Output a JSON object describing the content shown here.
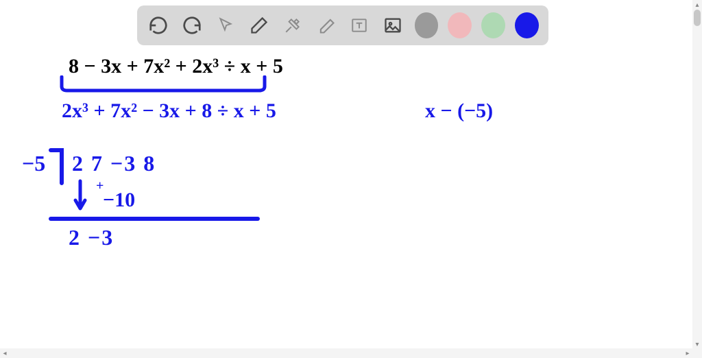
{
  "toolbar": {
    "tools": [
      {
        "name": "undo-icon",
        "type": "undo"
      },
      {
        "name": "redo-icon",
        "type": "redo"
      },
      {
        "name": "pointer-icon",
        "type": "pointer"
      },
      {
        "name": "pencil-icon",
        "type": "pencil"
      },
      {
        "name": "tools-icon",
        "type": "tools"
      },
      {
        "name": "eraser-icon",
        "type": "eraser"
      },
      {
        "name": "text-icon",
        "type": "text"
      },
      {
        "name": "image-icon",
        "type": "image"
      }
    ],
    "colors": [
      {
        "name": "color-gray",
        "hex": "#9a9a9a"
      },
      {
        "name": "color-pink",
        "hex": "#f1b8bb"
      },
      {
        "name": "color-green",
        "hex": "#aed9b3"
      },
      {
        "name": "color-blue",
        "hex": "#1819e8"
      }
    ]
  },
  "math": {
    "line1": "8 − 3x + 7x² + 2x³   ÷   x + 5",
    "line2": "2x³ + 7x² − 3x + 8   ÷  x + 5",
    "side_note": "x − (−5)",
    "syn_divisor": "−5",
    "syn_row1": "2    7    −3    8",
    "syn_plus": "+",
    "syn_row2": "−10",
    "syn_result": "2  −3"
  }
}
